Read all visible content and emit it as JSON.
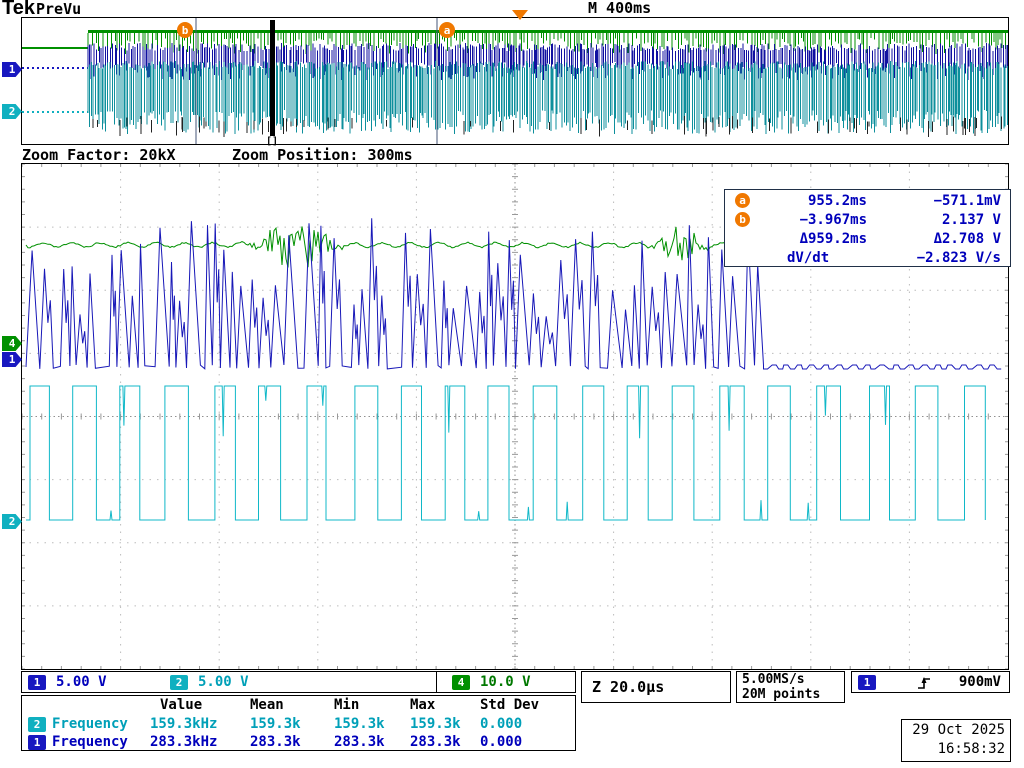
{
  "colors": {
    "ch1": "#1818c0",
    "ch2": "#10b0c0",
    "ch4": "#009000",
    "marker_orange": "#f07800",
    "readout_blue": "#0000bb"
  },
  "header": {
    "brand": "Tek",
    "acq_mode": "PreVu",
    "timebase": "M 400ms"
  },
  "overview": {
    "bracket_label": "[]"
  },
  "zoom": {
    "factor": "Zoom Factor: 20kX",
    "position": "Zoom Position: 300ms"
  },
  "cursors": {
    "a_label": "a",
    "b_label": "b",
    "a_time": "955.2ms",
    "a_value": "−571.1mV",
    "b_time": "−3.967ms",
    "b_value": "2.137 V",
    "delta_time": "Δ959.2ms",
    "delta_value": "Δ2.708 V",
    "dvdt_label": "dV/dt",
    "dvdt_value": "−2.823 V/s"
  },
  "channels": [
    {
      "num": "1",
      "scale": "5.00 V"
    },
    {
      "num": "2",
      "scale": "5.00 V"
    },
    {
      "num": "4",
      "scale": "10.0 V"
    }
  ],
  "horizontal": {
    "zoom_scale": "Z 20.0µs",
    "sample_rate": "5.00MS/s",
    "record_length": "20M points"
  },
  "trigger": {
    "source": "1",
    "level": "900mV"
  },
  "measurements": {
    "headers": [
      "Value",
      "Mean",
      "Min",
      "Max",
      "Std Dev"
    ],
    "rows": [
      {
        "ch": "2",
        "name": "Frequency",
        "value": "159.3kHz",
        "mean": "159.3k",
        "min": "159.3k",
        "max": "159.3k",
        "stddev": "0.000"
      },
      {
        "ch": "1",
        "name": "Frequency",
        "value": "283.3kHz",
        "mean": "283.3k",
        "min": "283.3k",
        "max": "283.3k",
        "stddev": "0.000"
      }
    ]
  },
  "clock": {
    "date": "29 Oct 2025",
    "time": "16:58:32"
  }
}
